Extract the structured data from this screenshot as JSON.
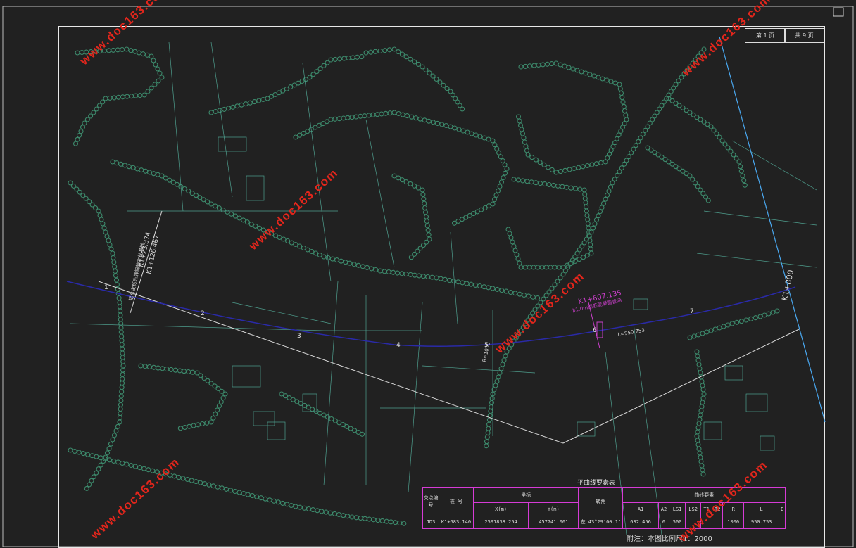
{
  "colors": {
    "background": "#212121",
    "frame": "#dcdcdc",
    "terrain": "#3d8a6c",
    "parcel_lines": "#4fa08f",
    "alignment": "#2a2a9e",
    "annotation": "#c93fc9",
    "watermark": "#e2261c",
    "table_border": "#2ecbd8"
  },
  "watermark": "www.doc163.com",
  "sheet": {
    "label_1": "第 1 页",
    "label_2": "共 9 页"
  },
  "annotations": {
    "station_end": "K1+800",
    "station_mid": "K1+607.135",
    "station_mid_sub": "ф1.0m钢筋混凝圆管涵",
    "station_left_1": "K1+23.374",
    "station_left_2": "K1+126.467",
    "station_left_note": "铝合金标志牌钢管立柱基础",
    "radius_note": "R=1000",
    "curve_note": "L=950.753",
    "pi_numbers": [
      "1",
      "2",
      "3",
      "4",
      "5",
      "6",
      "7"
    ]
  },
  "curve_table": {
    "title": "平曲线要素表",
    "headers": [
      "交点编号",
      "桩 号",
      "坐标",
      "转角",
      "曲线要素"
    ],
    "sub_headers": [
      "X(m)",
      "Y(m)",
      "A1",
      "A2",
      "LS1",
      "LS2",
      "T1",
      "T2",
      "R",
      "L",
      "E"
    ],
    "row": {
      "id": "JD3",
      "station": "K1+583.140",
      "x": "2591838.254",
      "y": "457741.001",
      "angle": "左 43°29'00.1\"",
      "a1": "632.456",
      "a2": "0",
      "ls1": "500",
      "ls2": "",
      "t1": "",
      "t2": "",
      "r": "1000",
      "l": "950.753",
      "e": ""
    }
  },
  "scale_text": "附注：本图比例尺1：2000"
}
